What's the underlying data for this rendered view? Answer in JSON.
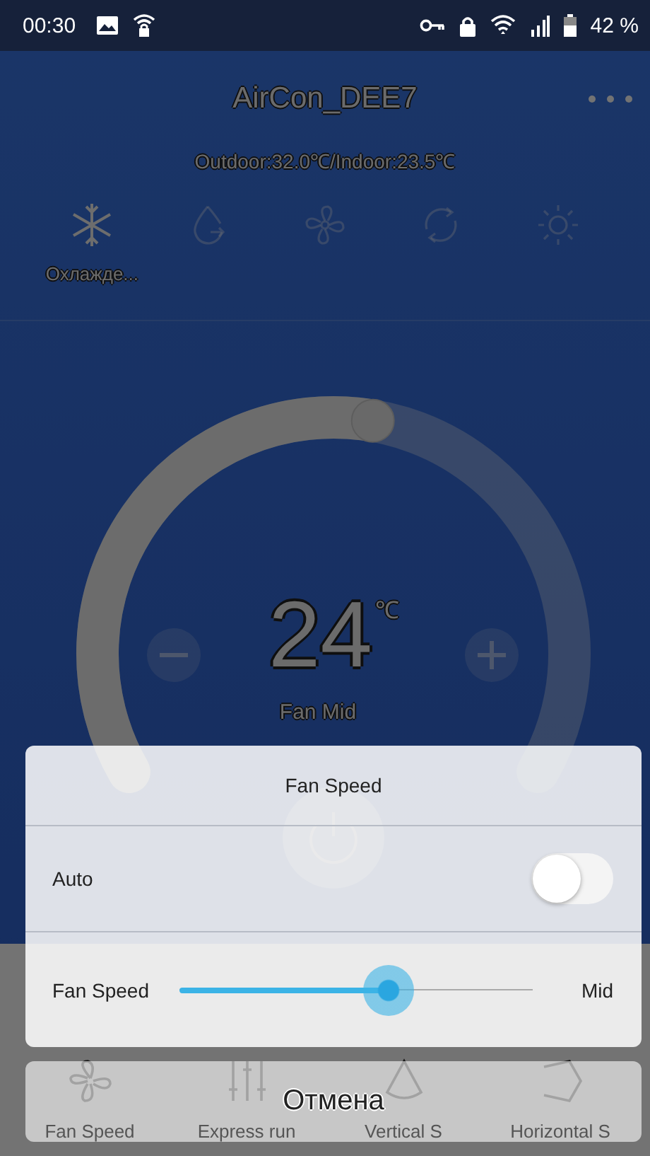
{
  "status_bar": {
    "time": "00:30",
    "battery": "42 %"
  },
  "header": {
    "title": "AirCon_DEE7",
    "temperatures": "Outdoor:32.0℃/Indoor:23.5℃"
  },
  "modes": [
    {
      "kind": "cool",
      "label": "Охлажде...",
      "selected": true
    },
    {
      "kind": "dry",
      "selected": false
    },
    {
      "kind": "fan",
      "selected": false
    },
    {
      "kind": "auto",
      "selected": false
    },
    {
      "kind": "heat",
      "selected": false
    }
  ],
  "setpoint": {
    "value": "24",
    "unit": "℃",
    "fan": "Fan Mid",
    "level": 0.54
  },
  "toolbar": [
    {
      "kind": "fan",
      "label": "Fan Speed"
    },
    {
      "kind": "sliders",
      "label": "Express run"
    },
    {
      "kind": "vertical",
      "label": "Vertical S"
    },
    {
      "kind": "horizontal",
      "label": "Horizontal S"
    }
  ],
  "dialog": {
    "title": "Fan Speed",
    "auto": {
      "label": "Auto",
      "on": false
    },
    "speed": {
      "label": "Fan Speed",
      "level": 0.59,
      "reading": "Mid"
    },
    "cancel": "Отмена"
  }
}
